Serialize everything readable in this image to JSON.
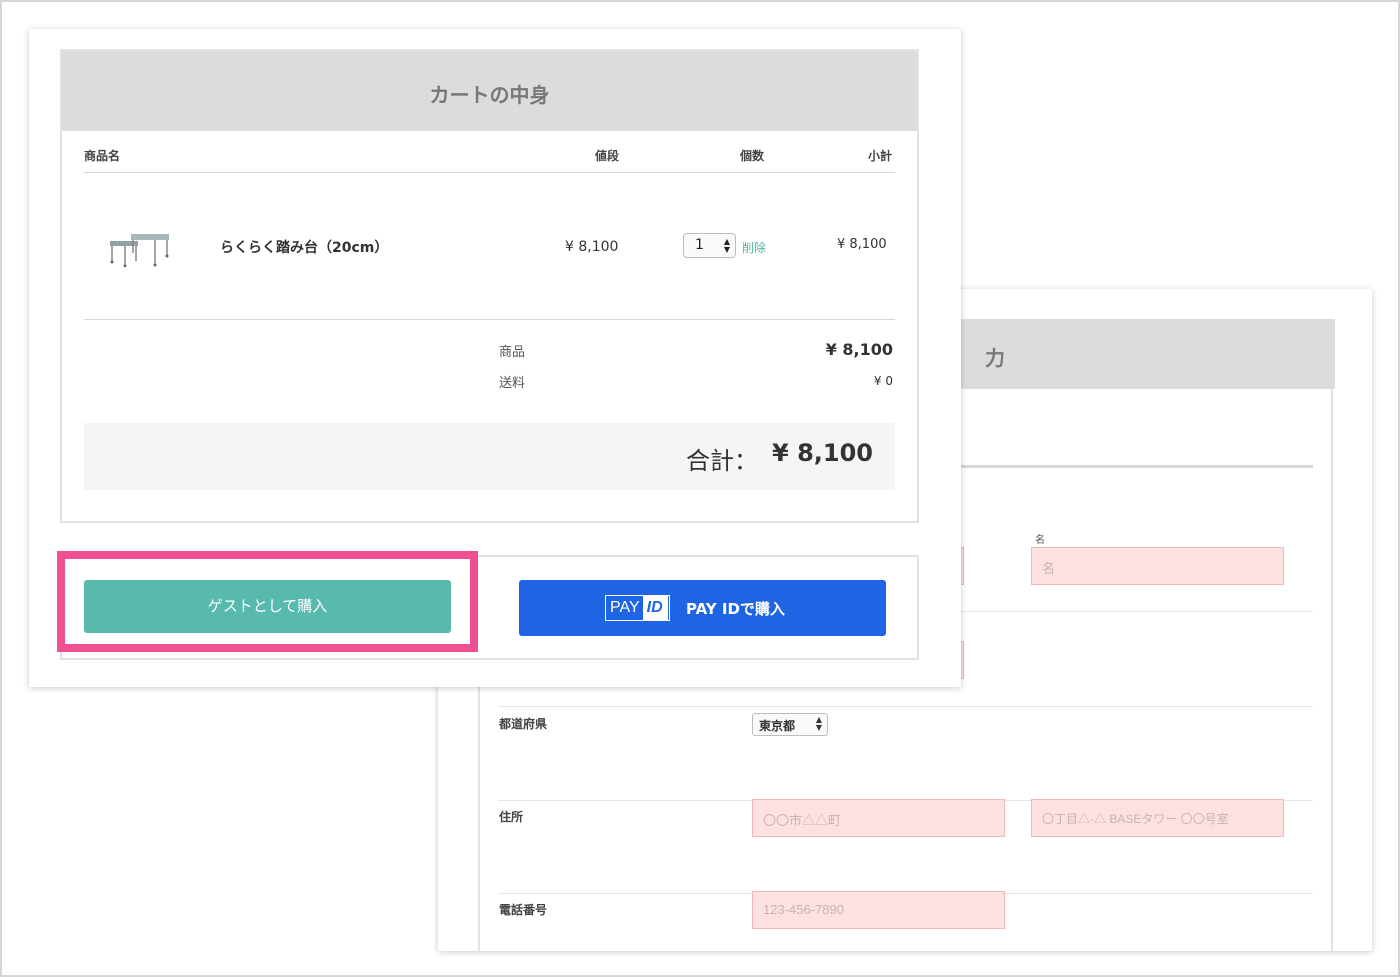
{
  "cart": {
    "title": "カートの中身",
    "columns": {
      "name": "商品名",
      "price": "値段",
      "qty": "個数",
      "subtotal": "小計"
    },
    "item": {
      "name": "らくらく踏み台（20cm）",
      "price": "¥ 8,100",
      "quantity": "1",
      "delete_label": "削除",
      "subtotal": "¥ 8,100",
      "image_icon": "step-stool-image"
    },
    "summary": {
      "items_label": "商品",
      "items_value": "¥ 8,100",
      "shipping_label": "送料",
      "shipping_value": "¥ 0"
    },
    "total": {
      "label": "合計：",
      "value": "¥ 8,100"
    }
  },
  "buttons": {
    "guest_label": "ゲストとして購入",
    "payid_logo_pay": "PAY",
    "payid_logo_id": "ID",
    "payid_label": "PAY IDで購入"
  },
  "form": {
    "header_title": "力",
    "first_name_label": "名",
    "first_name_placeholder": "名",
    "prefecture_label": "都道府県",
    "prefecture_value": "東京都",
    "address_label": "住所",
    "address1_placeholder": "〇〇市△△町",
    "address2_placeholder": "〇丁目△-△ BASEタワー 〇〇号室",
    "phone_label": "電話番号",
    "phone_placeholder": "123-456-7890"
  },
  "colors": {
    "guest_button": "#57baad",
    "payid_button": "#1f64e2",
    "highlight": "#ef4f93",
    "delete_link": "#4dbba0",
    "input_error_bg": "#fde0e0"
  }
}
